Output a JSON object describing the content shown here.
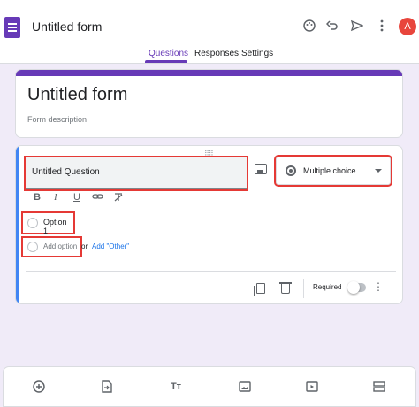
{
  "header": {
    "title": "Untitled form",
    "avatar_initial": "A"
  },
  "tabs": [
    {
      "label": "Questions",
      "active": true
    },
    {
      "label": "Responses",
      "active": false
    },
    {
      "label": "Settings",
      "active": false
    }
  ],
  "form": {
    "title": "Untitled form",
    "description": "Form description"
  },
  "question": {
    "title": "Untitled Question",
    "type": "Multiple choice",
    "options": [
      "Option 1"
    ],
    "add_option": "Add option",
    "or": "or",
    "add_other": "Add \"Other\"",
    "required_label": "Required"
  },
  "colors": {
    "accent": "#673ab7",
    "highlight": "#e53935",
    "link": "#1a73e8",
    "background": "#f0ebf8"
  }
}
